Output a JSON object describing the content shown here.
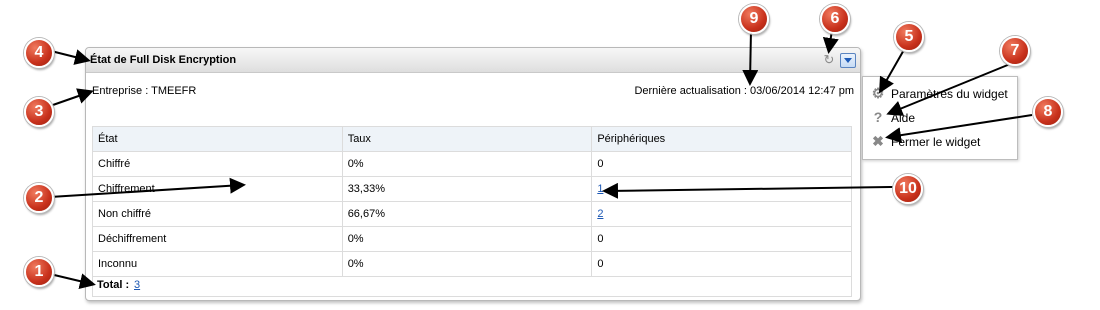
{
  "widget": {
    "title": "État de Full Disk Encryption",
    "company_label": "Entreprise : TMEEFR",
    "last_update_label": "Dernière actualisation : 03/06/2014 12:47 pm",
    "table": {
      "headers": [
        "État",
        "Taux",
        "Périphériques"
      ],
      "rows": [
        {
          "state": "Chiffré",
          "rate": "0%",
          "devices": "0"
        },
        {
          "state": "Chiffrement",
          "rate": "33,33%",
          "devices": "1"
        },
        {
          "state": "Non chiffré",
          "rate": "66,67%",
          "devices": "2"
        },
        {
          "state": "Déchiffrement",
          "rate": "0%",
          "devices": "0"
        },
        {
          "state": "Inconnu",
          "rate": "0%",
          "devices": "0"
        }
      ]
    },
    "total_label": "Total :",
    "total_value": "3"
  },
  "menu": {
    "items": [
      {
        "label": "Paramètres du widget",
        "icon": "gear-icon"
      },
      {
        "label": "Aide",
        "icon": "help-icon"
      },
      {
        "label": "Fermer le widget",
        "icon": "close-icon"
      }
    ]
  },
  "callouts": [
    "1",
    "2",
    "3",
    "4",
    "5",
    "6",
    "7",
    "8",
    "9",
    "10"
  ],
  "colors": {
    "callout": "#c8311c",
    "link": "#1b57b4",
    "header_bg": "#dedede"
  }
}
